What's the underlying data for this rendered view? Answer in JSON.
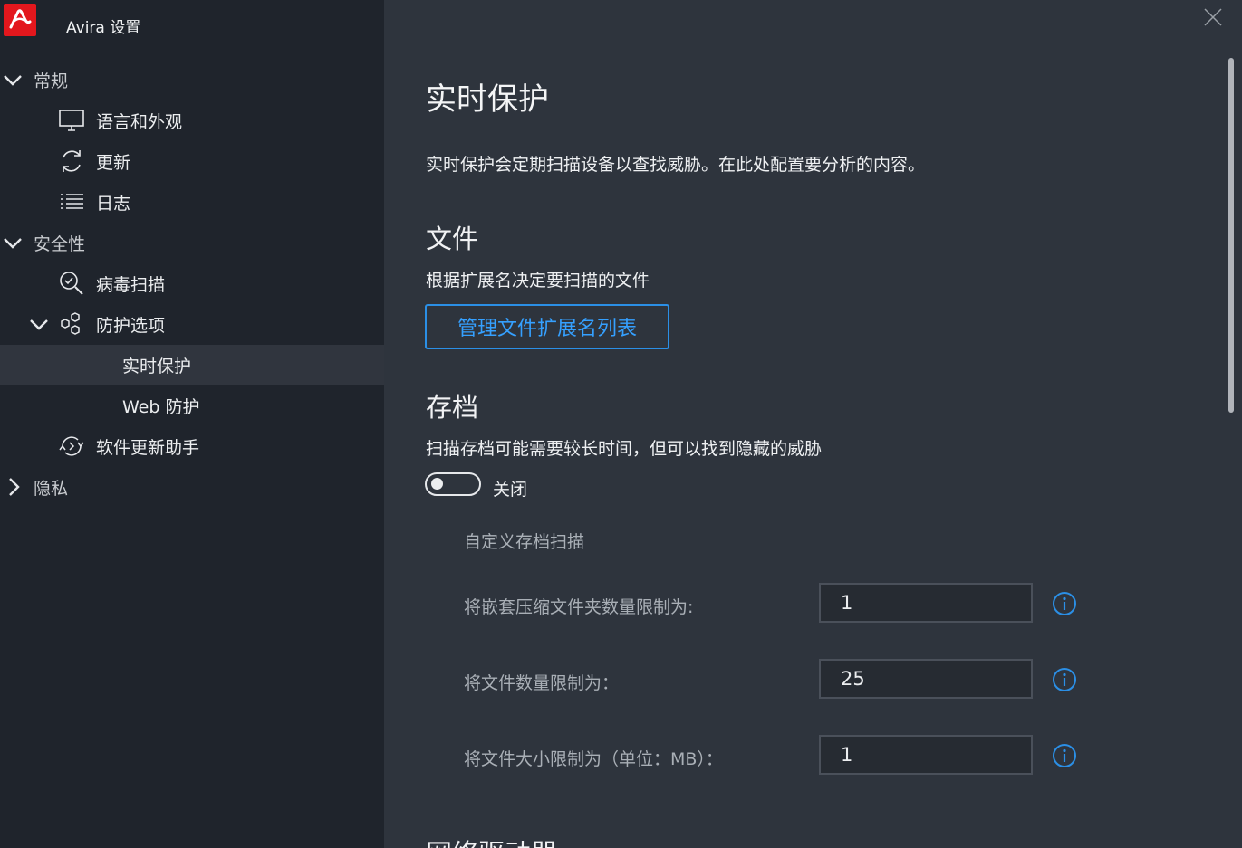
{
  "app": {
    "title": "Avira 设置",
    "accent": "#e3171d"
  },
  "sidebar": {
    "groups": [
      {
        "label": "常规",
        "expanded": true
      },
      {
        "label": "安全性",
        "expanded": true
      },
      {
        "label": "隐私",
        "expanded": false
      }
    ],
    "items": {
      "language": "语言和外观",
      "update": "更新",
      "log": "日志",
      "virus_scan": "病毒扫描",
      "protection_options": "防护选项",
      "realtime": "实时保护",
      "web": "Web 防护",
      "software_updater": "软件更新助手"
    },
    "selected": "实时保护"
  },
  "main": {
    "title": "实时保护",
    "description": "实时保护会定期扫描设备以查找威胁。在此处配置要分析的内容。",
    "files": {
      "heading": "文件",
      "description": "根据扩展名决定要扫描的文件",
      "button": "管理文件扩展名列表"
    },
    "archives": {
      "heading": "存档",
      "description": "扫描存档可能需要较长时间，但可以找到隐藏的威胁",
      "toggle_state": "关闭",
      "toggle_on": false,
      "custom_heading": "自定义存档扫描",
      "fields": [
        {
          "label": "将嵌套压缩文件夹数量限制为:",
          "value": "1"
        },
        {
          "label": "将文件数量限制为：",
          "value": "25"
        },
        {
          "label": "将文件大小限制为（单位：MB）：",
          "value": "1"
        }
      ]
    },
    "next_heading": "网络驱动器"
  },
  "colors": {
    "accent_blue": "#2b8fe6",
    "sidebar_bg": "#1f242c",
    "main_bg": "#2e343d"
  }
}
